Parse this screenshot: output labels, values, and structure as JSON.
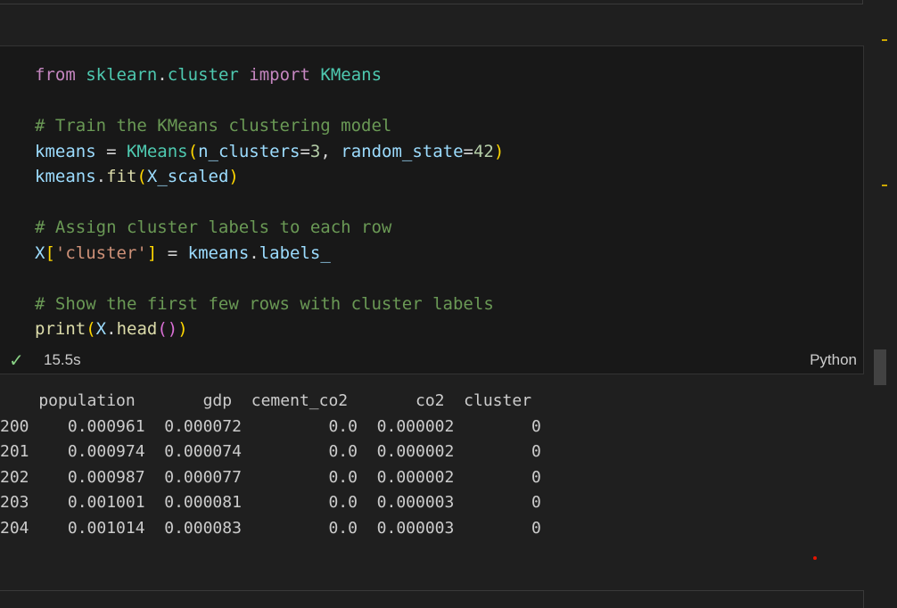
{
  "code_lines": [
    [
      {
        "t": "from",
        "c": "kw"
      },
      {
        "t": " "
      },
      {
        "t": "sklearn",
        "c": "mod"
      },
      {
        "t": "."
      },
      {
        "t": "cluster",
        "c": "mod"
      },
      {
        "t": " "
      },
      {
        "t": "import",
        "c": "kw"
      },
      {
        "t": " "
      },
      {
        "t": "KMeans",
        "c": "cls"
      }
    ],
    [],
    [
      {
        "t": "# Train the KMeans clustering model",
        "c": "cm"
      }
    ],
    [
      {
        "t": "kmeans",
        "c": "var"
      },
      {
        "t": " = "
      },
      {
        "t": "KMeans",
        "c": "cls"
      },
      {
        "t": "(",
        "c": "b1"
      },
      {
        "t": "n_clusters",
        "c": "var"
      },
      {
        "t": "="
      },
      {
        "t": "3",
        "c": "num"
      },
      {
        "t": ", "
      },
      {
        "t": "random_state",
        "c": "var"
      },
      {
        "t": "="
      },
      {
        "t": "42",
        "c": "num"
      },
      {
        "t": ")",
        "c": "b1"
      }
    ],
    [
      {
        "t": "kmeans",
        "c": "var"
      },
      {
        "t": "."
      },
      {
        "t": "fit",
        "c": "fn"
      },
      {
        "t": "(",
        "c": "b1"
      },
      {
        "t": "X_scaled",
        "c": "var"
      },
      {
        "t": ")",
        "c": "b1"
      }
    ],
    [],
    [
      {
        "t": "# Assign cluster labels to each row",
        "c": "cm"
      }
    ],
    [
      {
        "t": "X",
        "c": "var"
      },
      {
        "t": "[",
        "c": "b1"
      },
      {
        "t": "'cluster'",
        "c": "str"
      },
      {
        "t": "]",
        "c": "b1"
      },
      {
        "t": " = "
      },
      {
        "t": "kmeans",
        "c": "var"
      },
      {
        "t": "."
      },
      {
        "t": "labels_",
        "c": "var"
      }
    ],
    [],
    [
      {
        "t": "# Show the first few rows with cluster labels",
        "c": "cm"
      }
    ],
    [
      {
        "t": "print",
        "c": "fn"
      },
      {
        "t": "(",
        "c": "b1"
      },
      {
        "t": "X",
        "c": "var"
      },
      {
        "t": "."
      },
      {
        "t": "head",
        "c": "fn"
      },
      {
        "t": "()",
        "c": "b2"
      },
      {
        "t": ")",
        "c": "b1"
      }
    ]
  ],
  "status": {
    "check": "✓",
    "time": "15.5s",
    "language": "Python"
  },
  "output_lines": [
    "    population       gdp  cement_co2       co2  cluster",
    "200    0.000961  0.000072         0.0  0.000002        0",
    "201    0.000974  0.000074         0.0  0.000002        0",
    "202    0.000987  0.000077         0.0  0.000002        0",
    "203    0.001001  0.000081         0.0  0.000003        0",
    "204    0.001014  0.000083         0.0  0.000003        0"
  ],
  "colors": {
    "check": "#89d185",
    "keyword": "#c586c0",
    "class": "#4ec9b0",
    "comment": "#6a9955"
  }
}
